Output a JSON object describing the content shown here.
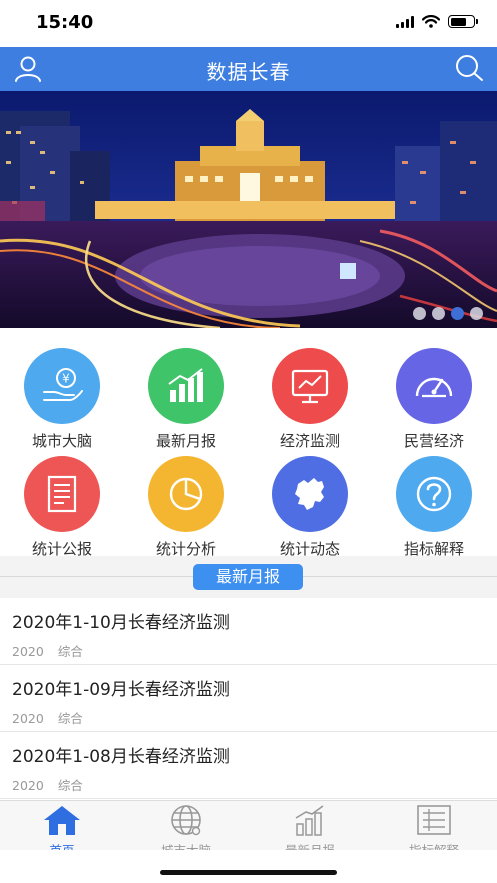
{
  "status_bar": {
    "time": "15:40"
  },
  "header": {
    "title": "数据长春",
    "user_icon": "user-icon",
    "search_icon": "search-icon"
  },
  "banner": {
    "slide_count": 4,
    "active_slide": 3
  },
  "grid": {
    "items": [
      {
        "label": "城市大脑",
        "icon": "yuan-hand-icon",
        "color": "#4fa9ef"
      },
      {
        "label": "最新月报",
        "icon": "bar-chart-icon",
        "color": "#3fc46a"
      },
      {
        "label": "经济监测",
        "icon": "monitor-chart-icon",
        "color": "#ee4c4c"
      },
      {
        "label": "民营经济",
        "icon": "gauge-icon",
        "color": "#6565e6"
      },
      {
        "label": "统计公报",
        "icon": "document-icon",
        "color": "#ee5656"
      },
      {
        "label": "统计分析",
        "icon": "pie-chart-icon",
        "color": "#f4b630"
      },
      {
        "label": "统计动态",
        "icon": "map-icon",
        "color": "#4f6ee3"
      },
      {
        "label": "指标解释",
        "icon": "question-icon",
        "color": "#4fa9ef"
      }
    ]
  },
  "section": {
    "title": "最新月报"
  },
  "news": [
    {
      "title": "2020年1-10月长春经济监测",
      "year": "2020",
      "category": "综合"
    },
    {
      "title": "2020年1-09月长春经济监测",
      "year": "2020",
      "category": "综合"
    },
    {
      "title": "2020年1-08月长春经济监测",
      "year": "2020",
      "category": "综合"
    }
  ],
  "tabbar": {
    "tabs": [
      {
        "label": "首页",
        "icon": "home-icon",
        "active": true
      },
      {
        "label": "城市大脑",
        "icon": "globe-icon",
        "active": false
      },
      {
        "label": "最新月报",
        "icon": "bar-chart-icon",
        "active": false
      },
      {
        "label": "指标解释",
        "icon": "list-icon",
        "active": false
      }
    ],
    "active_color": "#2f6ee0",
    "inactive_color": "#999999"
  }
}
